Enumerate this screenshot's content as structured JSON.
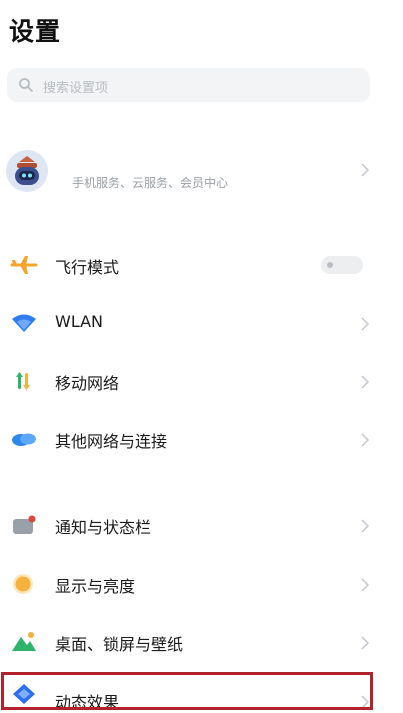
{
  "header": {
    "title": "设置"
  },
  "search": {
    "placeholder": "搜索设置项",
    "icon": "search-icon"
  },
  "account": {
    "subtitle": "手机服务、云服务、会员中心",
    "icon": "robot-avatar-icon"
  },
  "items": [
    {
      "label": "飞行模式",
      "icon": "airplane-icon",
      "control": "toggle",
      "toggle_on": false
    },
    {
      "label": "WLAN",
      "icon": "wifi-icon",
      "control": "chevron"
    },
    {
      "label": "移动网络",
      "icon": "mobile-data-icon",
      "control": "chevron"
    },
    {
      "label": "其他网络与连接",
      "icon": "cloud-connect-icon",
      "control": "chevron"
    },
    {
      "label": "通知与状态栏",
      "icon": "notification-icon",
      "control": "chevron"
    },
    {
      "label": "显示与亮度",
      "icon": "brightness-icon",
      "control": "chevron"
    },
    {
      "label": "桌面、锁屏与壁纸",
      "icon": "wallpaper-icon",
      "control": "chevron"
    },
    {
      "label": "动态效果",
      "icon": "motion-effects-icon",
      "control": "chevron"
    }
  ],
  "colors": {
    "highlight_border": "#b3222a",
    "airplane": "#f6a52c",
    "wifi": "#2f7bf0",
    "mobile_data": "#2fb36a",
    "brightness": "#f7b23b"
  }
}
